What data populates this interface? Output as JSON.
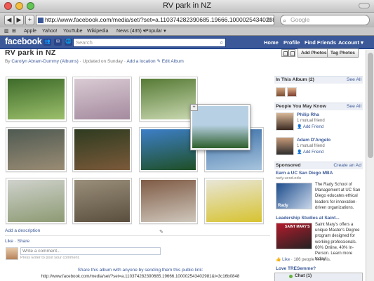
{
  "window": {
    "title": "RV park in NZ"
  },
  "browser": {
    "url": "http://www.facebook.com/media/set/?set=a.110374282390685.19666.100002543402981",
    "search_placeholder": "Google",
    "bookmarks": [
      "Apple",
      "Yahoo!",
      "YouTube",
      "Wikipedia",
      "News (435) ▾",
      "Popular ▾"
    ]
  },
  "fb": {
    "logo": "facebook",
    "search_placeholder": "Search",
    "nav": {
      "home": "Home",
      "profile": "Profile",
      "find_friends": "Find Friends",
      "account": "Account ▾"
    }
  },
  "album": {
    "title": "RV park in NZ",
    "by": "By",
    "owner": "Carolyn Abram-Dummy (Albums)",
    "updated": "· Updated on Sunday ·",
    "add_location": "Add a location",
    "edit_album": "✎ Edit Album",
    "add_photos": "Add Photos",
    "tag_photos": "Tag Photos",
    "add_description": "Add a description",
    "like": "Like",
    "dot": "·",
    "share": "Share",
    "comment_placeholder": "Write a comment...",
    "comment_hint": "Press Enter to post your comment.",
    "share_text": "Share this album with anyone by sending them this public link:",
    "share_url": "http://www.facebook.com/media/set/?set=a.110374282390685.19666.100002543402981&l=3c16b0848"
  },
  "photo_colors": [
    [
      "#3e6b2a",
      "#9bbf6b"
    ],
    [
      "#d9cbd3",
      "#a48a9e"
    ],
    [
      "#567a35",
      "#c9d8b0"
    ],
    [
      "#4f5a52",
      "#9a8c74"
    ],
    [
      "#2e3b20",
      "#7b5a3a"
    ],
    [
      "#3d7fc9",
      "#1f4f25"
    ],
    [
      "#3b6fa8",
      "#a7c4dd"
    ],
    [
      "#cfd2cc",
      "#8d9a73"
    ],
    [
      "#9a8f7a",
      "#5a4e3e"
    ],
    [
      "#7f5b45",
      "#cfc7bc"
    ],
    [
      "#e8e6d8",
      "#d7c330"
    ]
  ],
  "drag_photo_colors": [
    "#b7d0e3",
    "#2d5e2a"
  ],
  "sidebar": {
    "in_album": {
      "title": "In This Album (2)",
      "see_all": "See All"
    },
    "pymk": {
      "title": "People You May Know",
      "see_all": "See All"
    },
    "people": [
      {
        "name": "Philip Rha",
        "mutual": "1 mutual friend",
        "add": "Add Friend"
      },
      {
        "name": "Adam D'Angelo",
        "mutual": "1 mutual friend",
        "add": "Add Friend"
      }
    ],
    "sponsored": {
      "title": "Sponsored",
      "create": "Create an Ad"
    },
    "ads": [
      {
        "title": "Earn a UC San Diego MBA",
        "url": "rady.ucsd.edu",
        "text": "The Rady School of Management at UC San Diego educates ethical leaders for innovation-driven organizations.",
        "img_label": "Rady"
      },
      {
        "title": "Leadership Studies at Saint...",
        "url": "",
        "text": "Saint Mary's offers a unique Master's Degree program designed for working professionals. 60% Online, 40% In-Person. Learn more today!",
        "img_label": "SAINT MARY'S"
      }
    ],
    "like_line": {
      "like": "Like",
      "rest": "· 186 people like this."
    },
    "love_title": "Love TRESemme?",
    "chat": "Chat (1)"
  }
}
